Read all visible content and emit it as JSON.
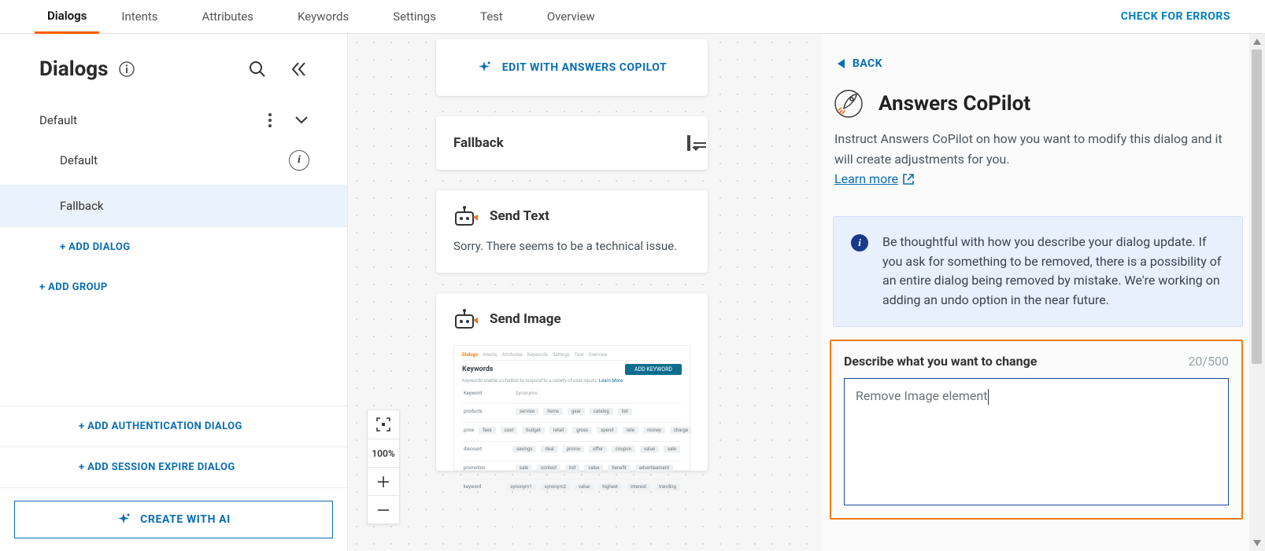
{
  "nav": {
    "tabs": [
      "Dialogs",
      "Intents",
      "Attributes",
      "Keywords",
      "Settings",
      "Test",
      "Overview"
    ],
    "active_index": 0,
    "check_errors": "CHECK FOR ERRORS"
  },
  "sidebar": {
    "title": "Dialogs",
    "group": "Default",
    "items": [
      {
        "label": "Default",
        "has_info": true,
        "selected": false
      },
      {
        "label": "Fallback",
        "has_info": false,
        "selected": true
      }
    ],
    "add_dialog": "+ ADD DIALOG",
    "add_group": "+ ADD GROUP",
    "add_auth": "+ ADD AUTHENTICATION DIALOG",
    "add_session": "+ ADD SESSION EXPIRE DIALOG",
    "create_ai": "CREATE WITH AI"
  },
  "canvas": {
    "edit_copilot": "EDIT WITH ANSWERS COPILOT",
    "fallback_title": "Fallback",
    "send_text_title": "Send Text",
    "send_text_body": "Sorry. There seems to be a technical issue.",
    "send_image_title": "Send Image",
    "preview": {
      "nav": [
        "Dialogs",
        "Intents",
        "Attributes",
        "Keywords",
        "Settings",
        "Test",
        "Overview"
      ],
      "title": "Keywords",
      "subtitle": "Keywords enable a chatbot to respond to a variety of user inputs.",
      "learn_more": "Learn More",
      "button": "ADD KEYWORD",
      "col1": "Keyword",
      "col2": "Synonyms",
      "rows": [
        {
          "k": "products",
          "s": [
            "service",
            "items",
            "gear",
            "catalog",
            "list"
          ]
        },
        {
          "k": "price",
          "s": [
            "fees",
            "cost",
            "budget",
            "retail",
            "gross",
            "spend",
            "rate",
            "money",
            "charge"
          ]
        },
        {
          "k": "discount",
          "s": [
            "savings",
            "deal",
            "promo",
            "offer",
            "coupon",
            "value",
            "sale"
          ]
        },
        {
          "k": "promotion",
          "s": [
            "sale",
            "contest",
            "bid",
            "value",
            "benefit",
            "advertisement"
          ]
        },
        {
          "k": "keyword",
          "s": [
            "synonym1",
            "synonym2",
            "value",
            "highest",
            "interest",
            "trending"
          ]
        }
      ]
    },
    "zoom": {
      "label": "100%"
    }
  },
  "right": {
    "back": "BACK",
    "title": "Answers CoPilot",
    "desc": "Instruct Answers CoPilot on how you want to modify this dialog and it will create adjustments for you.",
    "learn_more": "Learn more",
    "info": "Be thoughtful with how you describe your dialog update. If you ask for something to be removed, there is a possibility of an entire dialog being removed by mistake. We're working on adding an undo option in the near future.",
    "describe_label": "Describe what you want to change",
    "counter": "20/500",
    "textarea_value": "Remove Image element"
  }
}
